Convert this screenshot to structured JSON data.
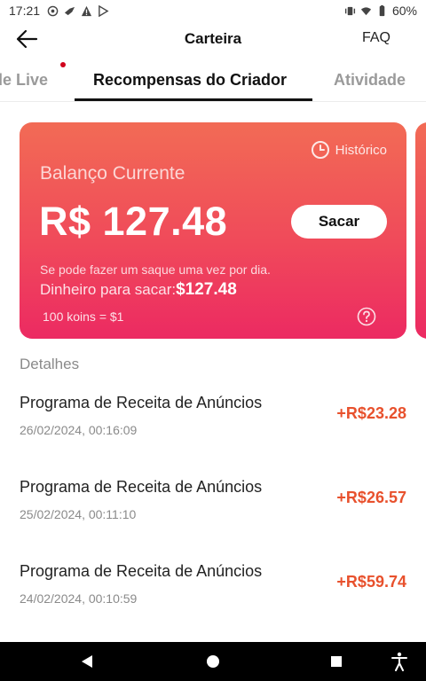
{
  "status_bar": {
    "time": "17:21",
    "battery": "60%"
  },
  "header": {
    "title": "Carteira",
    "faq_label": "FAQ"
  },
  "tabs": [
    {
      "label": "de Live",
      "has_dot": true
    },
    {
      "label": "Recompensas do Criador",
      "active": true
    },
    {
      "label": "Atividade"
    }
  ],
  "card": {
    "history_label": "Histórico",
    "balance_label": "Balanço Currente",
    "balance_amount": "R$ 127.48",
    "withdraw_label": "Sacar",
    "note": "Se pode fazer um saque uma vez por dia.",
    "available_label": "Dinheiro para sacar:",
    "available_value": "$127.48",
    "rate": "100 koins = $1"
  },
  "details": {
    "title": "Detalhes",
    "transactions": [
      {
        "name": "Programa de Receita de Anúncios",
        "date": "26/02/2024, 00:16:09",
        "amount": "+R$23.28"
      },
      {
        "name": "Programa de Receita de Anúncios",
        "date": "25/02/2024, 00:11:10",
        "amount": "+R$26.57"
      },
      {
        "name": "Programa de Receita de Anúncios",
        "date": "24/02/2024, 00:10:59",
        "amount": "+R$59.74"
      }
    ]
  },
  "colors": {
    "accent": "#e8512d",
    "card_top": "#f26b55",
    "card_bottom": "#ec2a62"
  }
}
